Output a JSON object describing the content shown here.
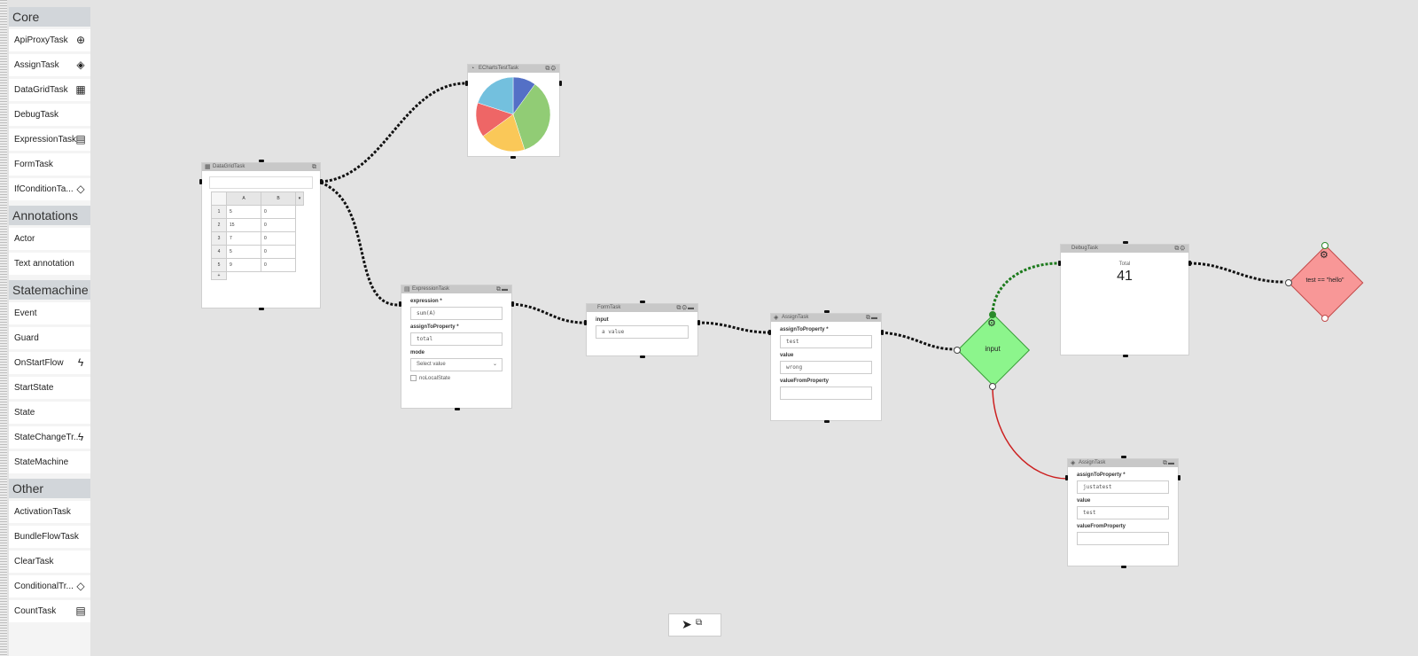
{
  "sidebar": {
    "sections": [
      {
        "title": "Core",
        "items": [
          {
            "label": "ApiProxyTask",
            "icon": "globe-icon"
          },
          {
            "label": "AssignTask",
            "icon": "cube-icon"
          },
          {
            "label": "DataGridTask",
            "icon": "table-icon"
          },
          {
            "label": "DebugTask",
            "icon": ""
          },
          {
            "label": "ExpressionTask",
            "icon": "calculator-icon"
          },
          {
            "label": "FormTask",
            "icon": ""
          },
          {
            "label": "IfConditionTa...",
            "icon": "diamond-icon"
          }
        ]
      },
      {
        "title": "Annotations",
        "items": [
          {
            "label": "Actor",
            "icon": ""
          },
          {
            "label": "Text annotation",
            "icon": ""
          }
        ]
      },
      {
        "title": "Statemachine",
        "items": [
          {
            "label": "Event",
            "icon": ""
          },
          {
            "label": "Guard",
            "icon": ""
          },
          {
            "label": "OnStartFlow",
            "icon": "bolt-icon"
          },
          {
            "label": "StartState",
            "icon": ""
          },
          {
            "label": "State",
            "icon": ""
          },
          {
            "label": "StateChangeTr...",
            "icon": "bolt-icon"
          },
          {
            "label": "StateMachine",
            "icon": ""
          }
        ]
      },
      {
        "title": "Other",
        "items": [
          {
            "label": "ActivationTask",
            "icon": ""
          },
          {
            "label": "BundleFlowTask",
            "icon": ""
          },
          {
            "label": "ClearTask",
            "icon": ""
          },
          {
            "label": "ConditionalTr...",
            "icon": "diamond-icon"
          },
          {
            "label": "CountTask",
            "icon": "calculator-icon"
          }
        ]
      }
    ]
  },
  "nodes": {
    "datagrid": {
      "title": "DataGridTask",
      "columns": [
        "A",
        "B"
      ],
      "rows": [
        [
          "1",
          "5",
          "0"
        ],
        [
          "2",
          "15",
          "0"
        ],
        [
          "3",
          "7",
          "0"
        ],
        [
          "4",
          "5",
          "0"
        ],
        [
          "5",
          "9",
          "0"
        ]
      ],
      "add_label": "+"
    },
    "echarts": {
      "title": "EChartsTestTask",
      "chart_data": {
        "type": "pie",
        "values": [
          10,
          35,
          20,
          15,
          20
        ],
        "colors": [
          "#5470c6",
          "#91cc75",
          "#fac858",
          "#ee6666",
          "#73c0de"
        ]
      }
    },
    "expression": {
      "title": "ExpressionTask",
      "expression_label": "expression *",
      "expression_value": "sum(A)",
      "assign_label": "assignToProperty *",
      "assign_value": "total",
      "mode_label": "mode",
      "mode_placeholder": "Select value",
      "nolocal_label": "noLocalState"
    },
    "form": {
      "title": "FormTask",
      "input_label": "input",
      "input_value": "a value"
    },
    "assign1": {
      "title": "AssignTask",
      "assign_label": "assignToProperty *",
      "assign_value": "test",
      "value_label": "value",
      "value_value": "wrong",
      "vfp_label": "valueFromProperty",
      "vfp_value": ""
    },
    "condition": {
      "label": "input",
      "color": "#8cf58c"
    },
    "debug": {
      "title": "DebugTask",
      "total_label": "Total",
      "total_value": "41"
    },
    "condition2": {
      "label": "test == \"hello\"",
      "color": "#f89797"
    },
    "assign2": {
      "title": "AssignTask",
      "assign_label": "assignToProperty *",
      "assign_value": "justatest",
      "value_label": "value",
      "value_value": "test",
      "vfp_label": "valueFromProperty",
      "vfp_value": ""
    }
  },
  "colors": {
    "wire": "#111111",
    "wire_success": "#1c7a1c",
    "wire_fail": "#cc2020"
  }
}
